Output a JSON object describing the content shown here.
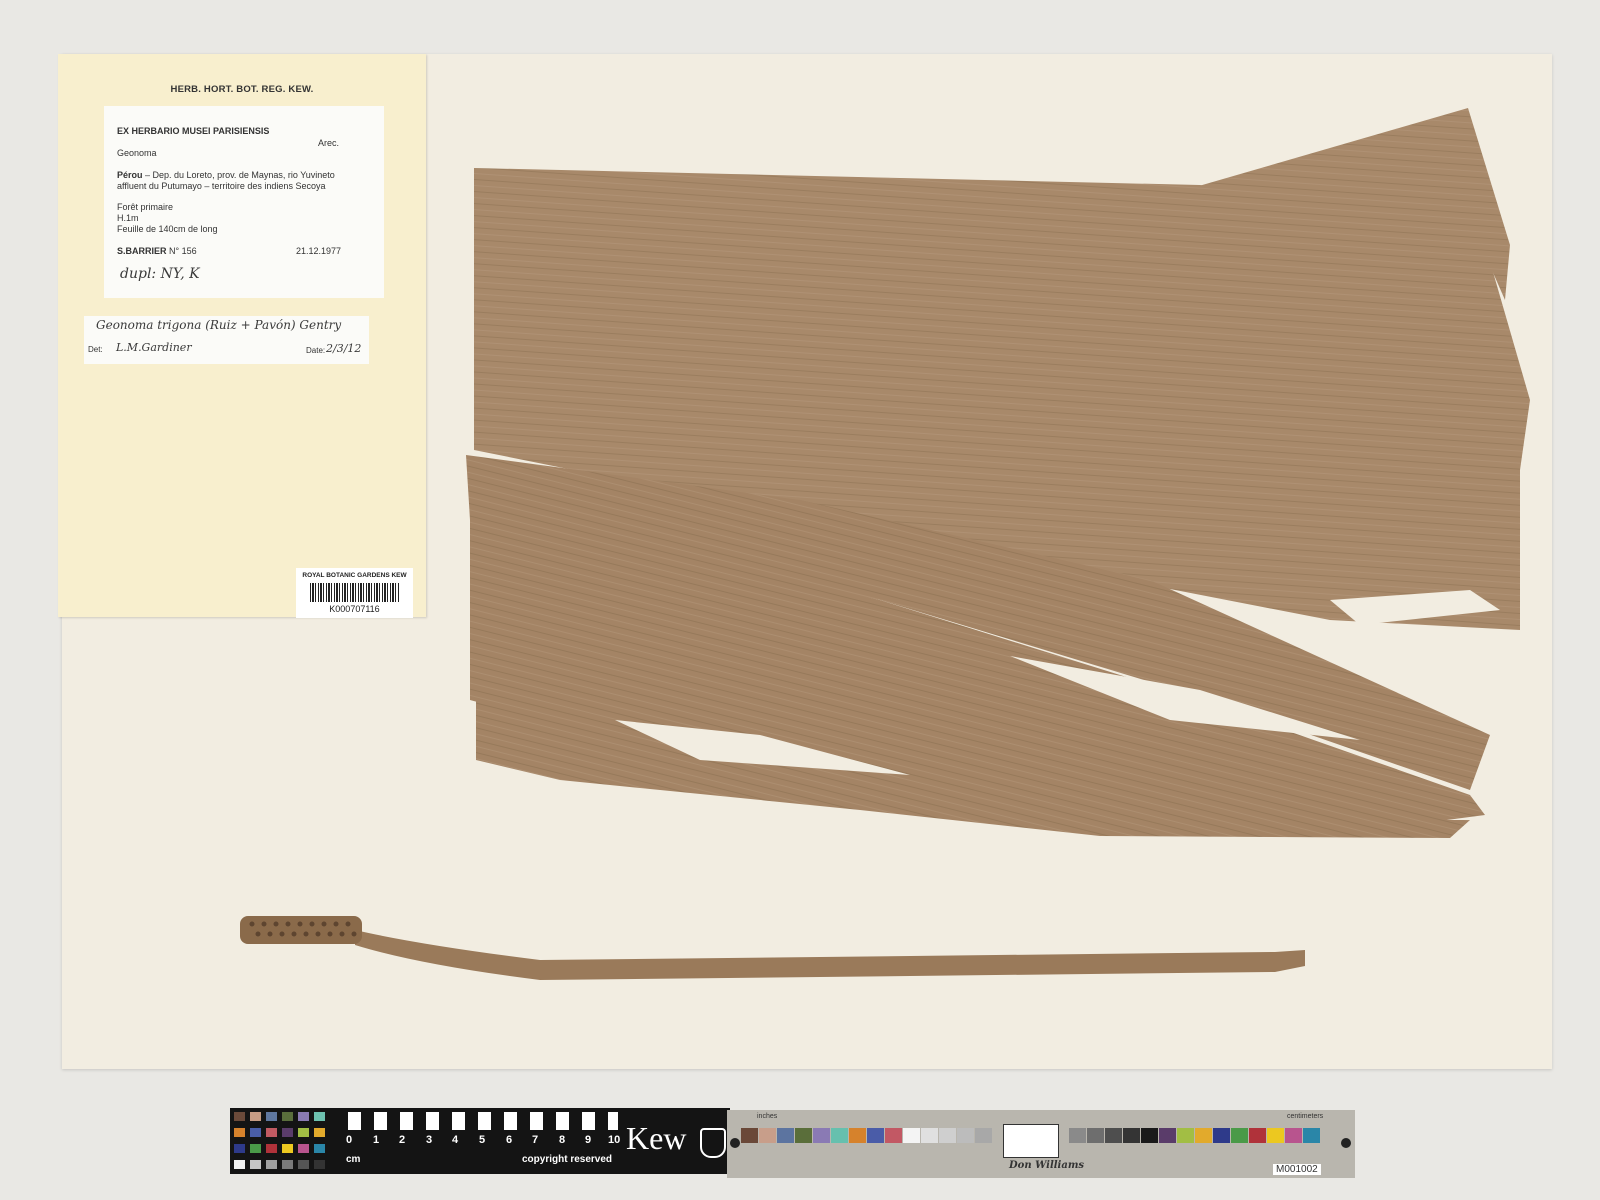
{
  "header": {
    "herbarium": "HERB. HORT. BOT. REG. KEW."
  },
  "label": {
    "title": "EX HERBARIO MUSEI PARISIENSIS",
    "family": "Arec.",
    "genus": "Geonoma",
    "locality_country": "Pérou",
    "locality_line1": " – Dep. du Loreto, prov. de Maynas, rio Yuvineto",
    "locality_line2": "affluent du Putumayo – territoire des indiens Secoya",
    "habitat": "Forêt primaire",
    "height": "H.1m",
    "leaf": "Feuille de 140cm de long",
    "collector": "S.BARRIER",
    "number": " N° 156",
    "date": "21.12.1977",
    "dupl": "dupl: NY, K"
  },
  "determination": {
    "name": "Geonoma trigona  (Ruiz + Pavón) Gentry",
    "det_label": "Det:",
    "det_value": "L.M.Gardiner",
    "date_label": "Date:",
    "date_value": "2/3/12"
  },
  "barcode": {
    "institution": "ROYAL BOTANIC GARDENS KEW",
    "id": "K000707116"
  },
  "scale": {
    "numbers": [
      "0",
      "1",
      "2",
      "3",
      "4",
      "5",
      "6",
      "7",
      "8",
      "9",
      "10"
    ],
    "unit": "cm",
    "copyright": "copyright reserved",
    "brand": "Kew"
  },
  "color_card": {
    "inches": "inches",
    "centimeters": "centimeters",
    "signature": "Don Williams",
    "code": "M001002"
  },
  "colors": {
    "background": "#e9e8e4",
    "sheet": "#f2ede1",
    "folder": "#f8efce",
    "leaf": "#a88a68",
    "leaf_dark": "#8d7152",
    "stalk": "#9a7a5a"
  }
}
